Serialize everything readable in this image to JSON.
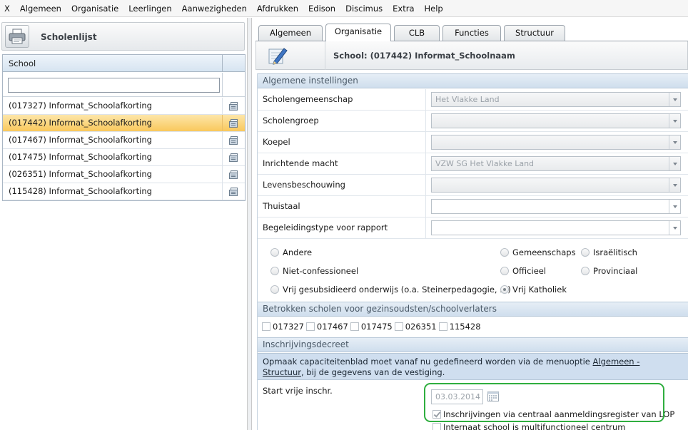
{
  "menu": [
    "X",
    "Algemeen",
    "Organisatie",
    "Leerlingen",
    "Aanwezigheden",
    "Afdrukken",
    "Edison",
    "Discimus",
    "Extra",
    "Help"
  ],
  "left": {
    "title": "Scholenlijst",
    "column_header": "School",
    "filter_value": "",
    "schools": [
      "(017327) Informat_Schoolafkorting",
      "(017442) Informat_Schoolafkorting",
      "(017467) Informat_Schoolafkorting",
      "(017475) Informat_Schoolafkorting",
      "(026351) Informat_Schoolafkorting",
      "(115428) Informat_Schoolafkorting"
    ],
    "selected_index": 1
  },
  "tabs": [
    "Algemeen",
    "Organisatie",
    "CLB",
    "Functies",
    "Structuur"
  ],
  "active_tab": "Organisatie",
  "school_title": "School: (017442) Informat_Schoolnaam",
  "sections": {
    "general": "Algemene instellingen",
    "involved": "Betrokken scholen voor gezinsoudsten/schoolverlaters",
    "enrollment": "Inschrijvingsdecreet"
  },
  "fields": [
    {
      "label": "Scholengemeenschap",
      "value": "Het Vlakke Land",
      "white": false
    },
    {
      "label": "Scholengroep",
      "value": "",
      "white": false
    },
    {
      "label": "Koepel",
      "value": "",
      "white": false
    },
    {
      "label": "Inrichtende macht",
      "value": "VZW SG Het Vlakke Land",
      "white": false
    },
    {
      "label": "Levensbeschouwing",
      "value": "",
      "white": false
    },
    {
      "label": "Thuistaal",
      "value": "",
      "white": true
    },
    {
      "label": "Begeleidingstype voor rapport",
      "value": "",
      "white": true
    }
  ],
  "radios": {
    "andere": "Andere",
    "niet_confessioneel": "Niet-confessioneel",
    "vrij_gesubsidieerd": "Vrij gesubsidieerd onderwijs (o.a. Steinerpedagogie, ...)",
    "gemeenschaps": "Gemeenschaps",
    "officieel": "Officieel",
    "vrij_katholiek": "Vrij Katholiek",
    "israelitisch": "Israëlitisch",
    "provinciaal": "Provinciaal"
  },
  "involved_schools": [
    "017327",
    "017467",
    "017475",
    "026351",
    "115428"
  ],
  "info": {
    "text_before": "Opmaak capaciteitenblad moet vanaf nu gedefineerd worden via de menuoptie ",
    "link": "Algemeen - Structuur",
    "text_after": ", bij de gegevens van de vestiging."
  },
  "start": {
    "label": "Start vrije inschr.",
    "date": "03.03.2014",
    "option_lop": "Inschrijvingen via centraal aanmeldingsregister van LOP",
    "option_internaat": "Internaat school is multifunctioneel centrum"
  },
  "colors": {
    "selected_row": "#f9c85c",
    "section_header": "#cfdeed",
    "highlight": "#2fae3f"
  }
}
